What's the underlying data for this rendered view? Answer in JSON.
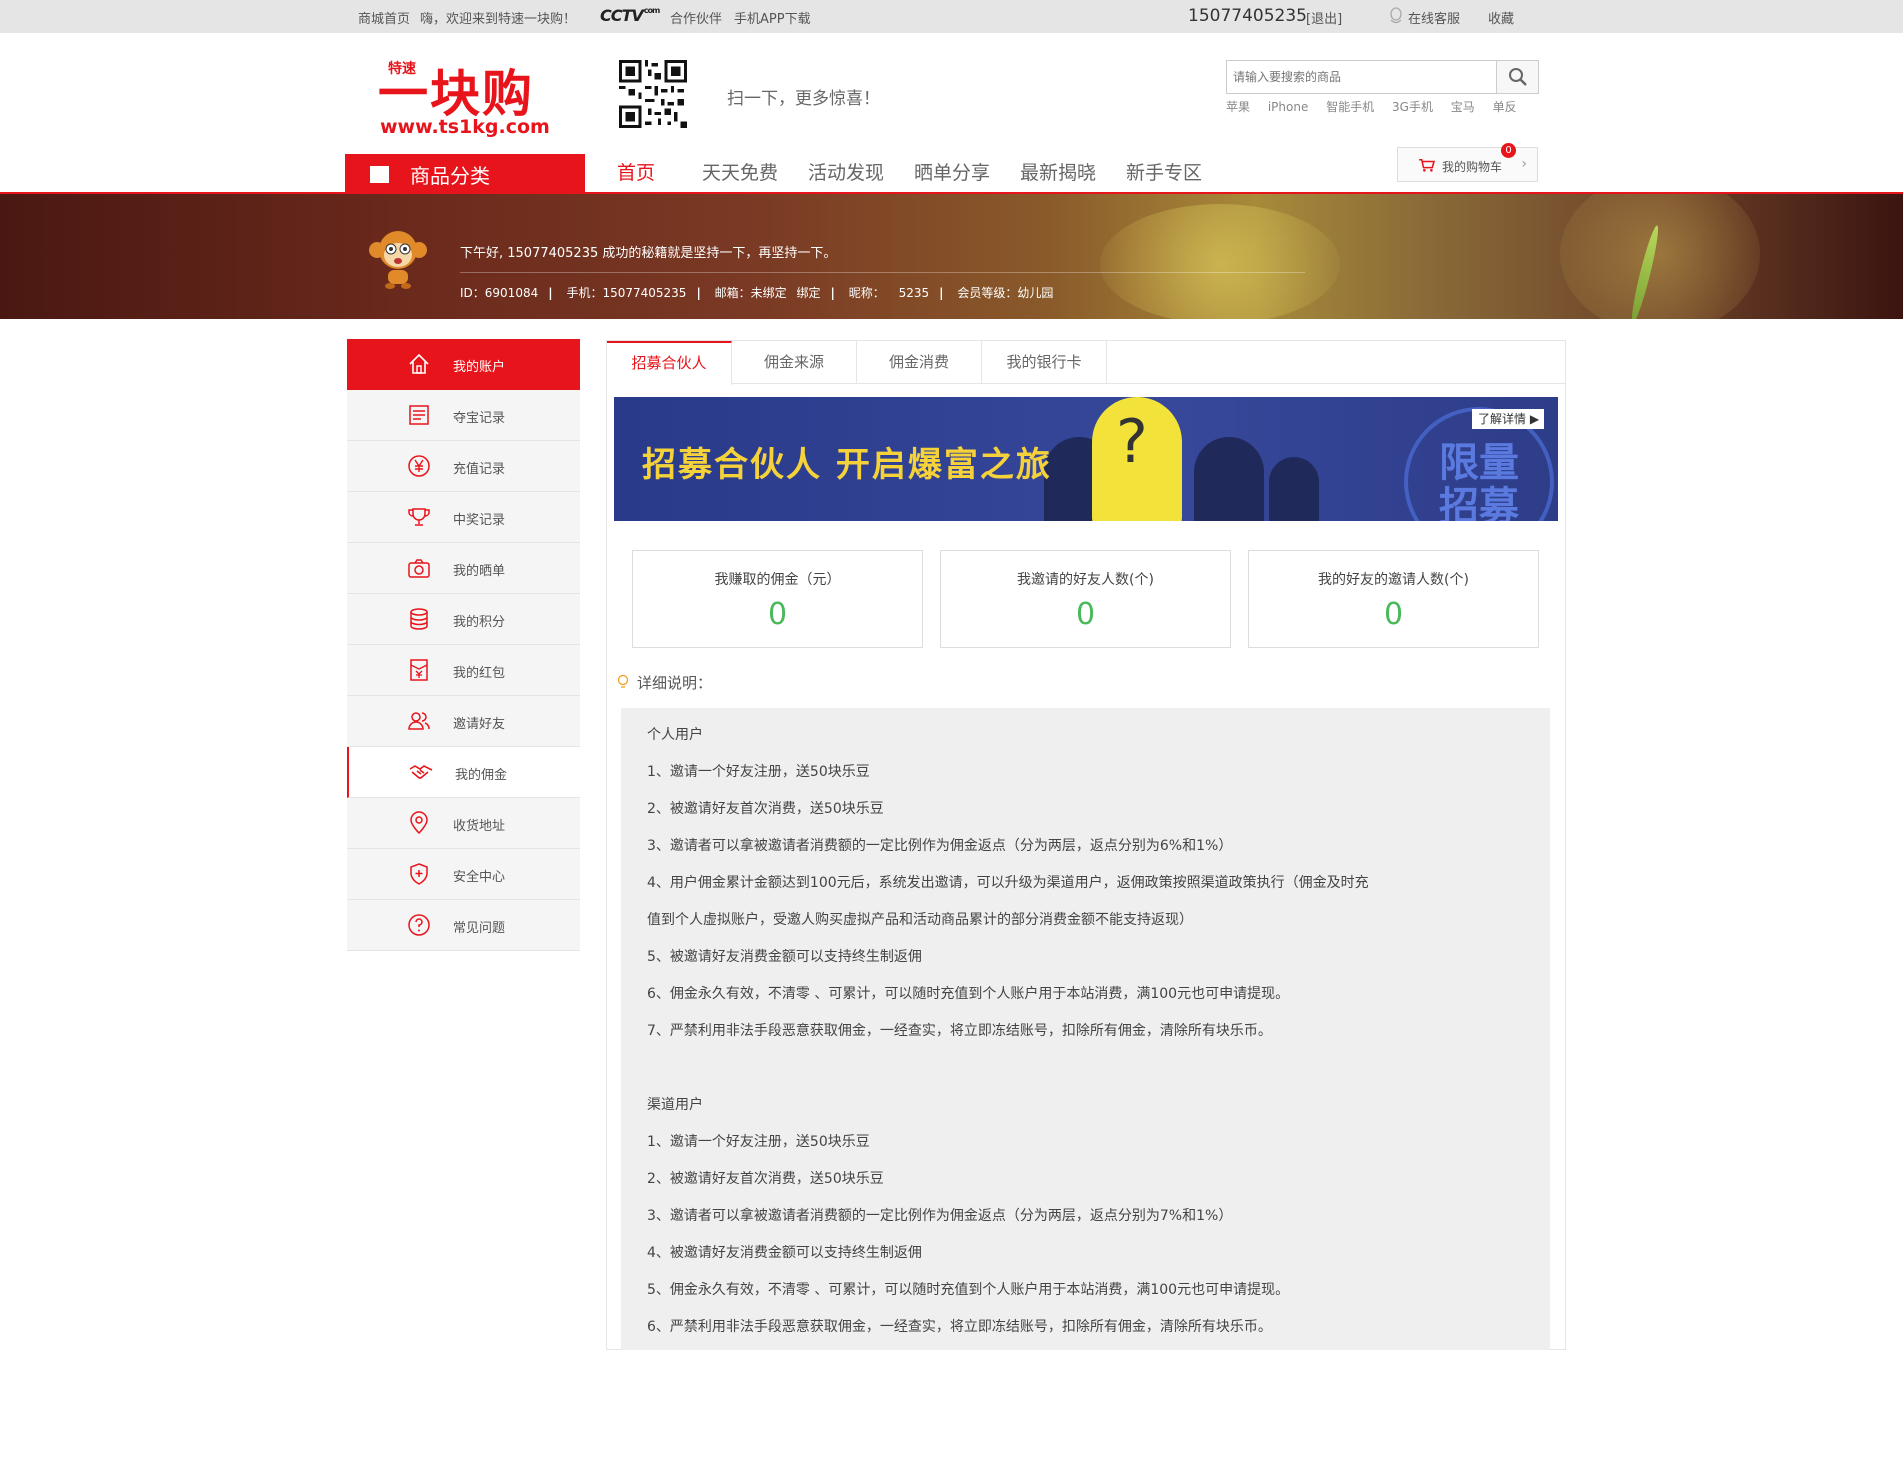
{
  "topbar": {
    "home": "商城首页",
    "welcome": "嗨，欢迎来到特速一块购！",
    "cctv": "CCTV",
    "cctv_com": "com",
    "partner": "合作伙伴",
    "app": "手机APP下载",
    "phone": "15077405235",
    "logout": "[退出]",
    "service": "在线客服",
    "favorite": "收藏"
  },
  "header": {
    "logo_main": "一块购",
    "logo_tag": "特速",
    "logo_url": "www.ts1kg.com",
    "scan_text": "扫一下，更多惊喜！",
    "search_placeholder": "请输入要搜索的商品",
    "hot_words": [
      "苹果",
      "iPhone",
      "智能手机",
      "3G手机",
      "宝马",
      "单反"
    ]
  },
  "nav": {
    "category": "商品分类",
    "items": [
      "首页",
      "天天免费",
      "活动发现",
      "晒单分享",
      "最新揭晓",
      "新手专区"
    ],
    "cart_label": "我的购物车",
    "cart_count": "0"
  },
  "banner": {
    "greeting": "下午好, 15077405235 成功的秘籍就是坚持一下，再坚持一下。",
    "id": "ID：6901084",
    "phone": "手机：15077405235",
    "email": "邮箱：未绑定",
    "bind": "绑定",
    "nickname_label": "昵称：",
    "nickname": "5235",
    "level": "会员等级：幼儿园"
  },
  "sidebar": {
    "items": [
      {
        "label": "我的账户",
        "icon": "home-icon"
      },
      {
        "label": "夺宝记录",
        "icon": "list-icon"
      },
      {
        "label": "充值记录",
        "icon": "yen-icon"
      },
      {
        "label": "中奖记录",
        "icon": "trophy-icon"
      },
      {
        "label": "我的晒单",
        "icon": "camera-icon"
      },
      {
        "label": "我的积分",
        "icon": "coins-icon"
      },
      {
        "label": "我的红包",
        "icon": "redpacket-icon"
      },
      {
        "label": "邀请好友",
        "icon": "users-icon"
      },
      {
        "label": "我的佣金",
        "icon": "handshake-icon"
      },
      {
        "label": "收货地址",
        "icon": "location-icon"
      },
      {
        "label": "安全中心",
        "icon": "shield-icon"
      },
      {
        "label": "常见问题",
        "icon": "question-icon"
      }
    ]
  },
  "tabs": [
    "招募合伙人",
    "佣金来源",
    "佣金消费",
    "我的银行卡"
  ],
  "promo": {
    "title": "招募合伙人 开启爆富之旅",
    "detail": "了解详情",
    "stamp_line1": "限量",
    "stamp_line2": "招募",
    "question": "?"
  },
  "stats": [
    {
      "label": "我赚取的佣金（元）",
      "value": "0"
    },
    {
      "label": "我邀请的好友人数(个)",
      "value": "0"
    },
    {
      "label": "我的好友的邀请人数(个)",
      "value": "0"
    }
  ],
  "detail_title": "详细说明：",
  "rules": [
    "个人用户",
    "1、邀请一个好友注册，送50块乐豆",
    "2、被邀请好友首次消费，送50块乐豆",
    "3、邀请者可以拿被邀请者消费额的一定比例作为佣金返点（分为两层，返点分别为6%和1%）",
    "4、用户佣金累计金额达到100元后，系统发出邀请，可以升级为渠道用户，返佣政策按照渠道政策执行（佣金及时充",
    "值到个人虚拟账户，受邀人购买虚拟产品和活动商品累计的部分消费金额不能支持返现）",
    "5、被邀请好友消费金额可以支持终生制返佣",
    "6、佣金永久有效，不清零 、可累计，可以随时充值到个人账户用于本站消费，满100元也可申请提现。",
    "7、严禁利用非法手段恶意获取佣金，一经查实，将立即冻结账号，扣除所有佣金，清除所有块乐币。",
    "",
    "渠道用户",
    "1、邀请一个好友注册，送50块乐豆",
    "2、被邀请好友首次消费，送50块乐豆",
    "3、邀请者可以拿被邀请者消费额的一定比例作为佣金返点（分为两层，返点分别为7%和1%）",
    "4、被邀请好友消费金额可以支持终生制返佣",
    "5、佣金永久有效，不清零 、可累计，可以随时充值到个人账户用于本站消费，满100元也可申请提现。",
    "6、严禁利用非法手段恶意获取佣金，一经查实，将立即冻结账号，扣除所有佣金，清除所有块乐币。"
  ],
  "colors": {
    "brand_red": "#e8141b",
    "stat_green": "#4bb95a",
    "promo_yellow": "#f5d23a"
  }
}
